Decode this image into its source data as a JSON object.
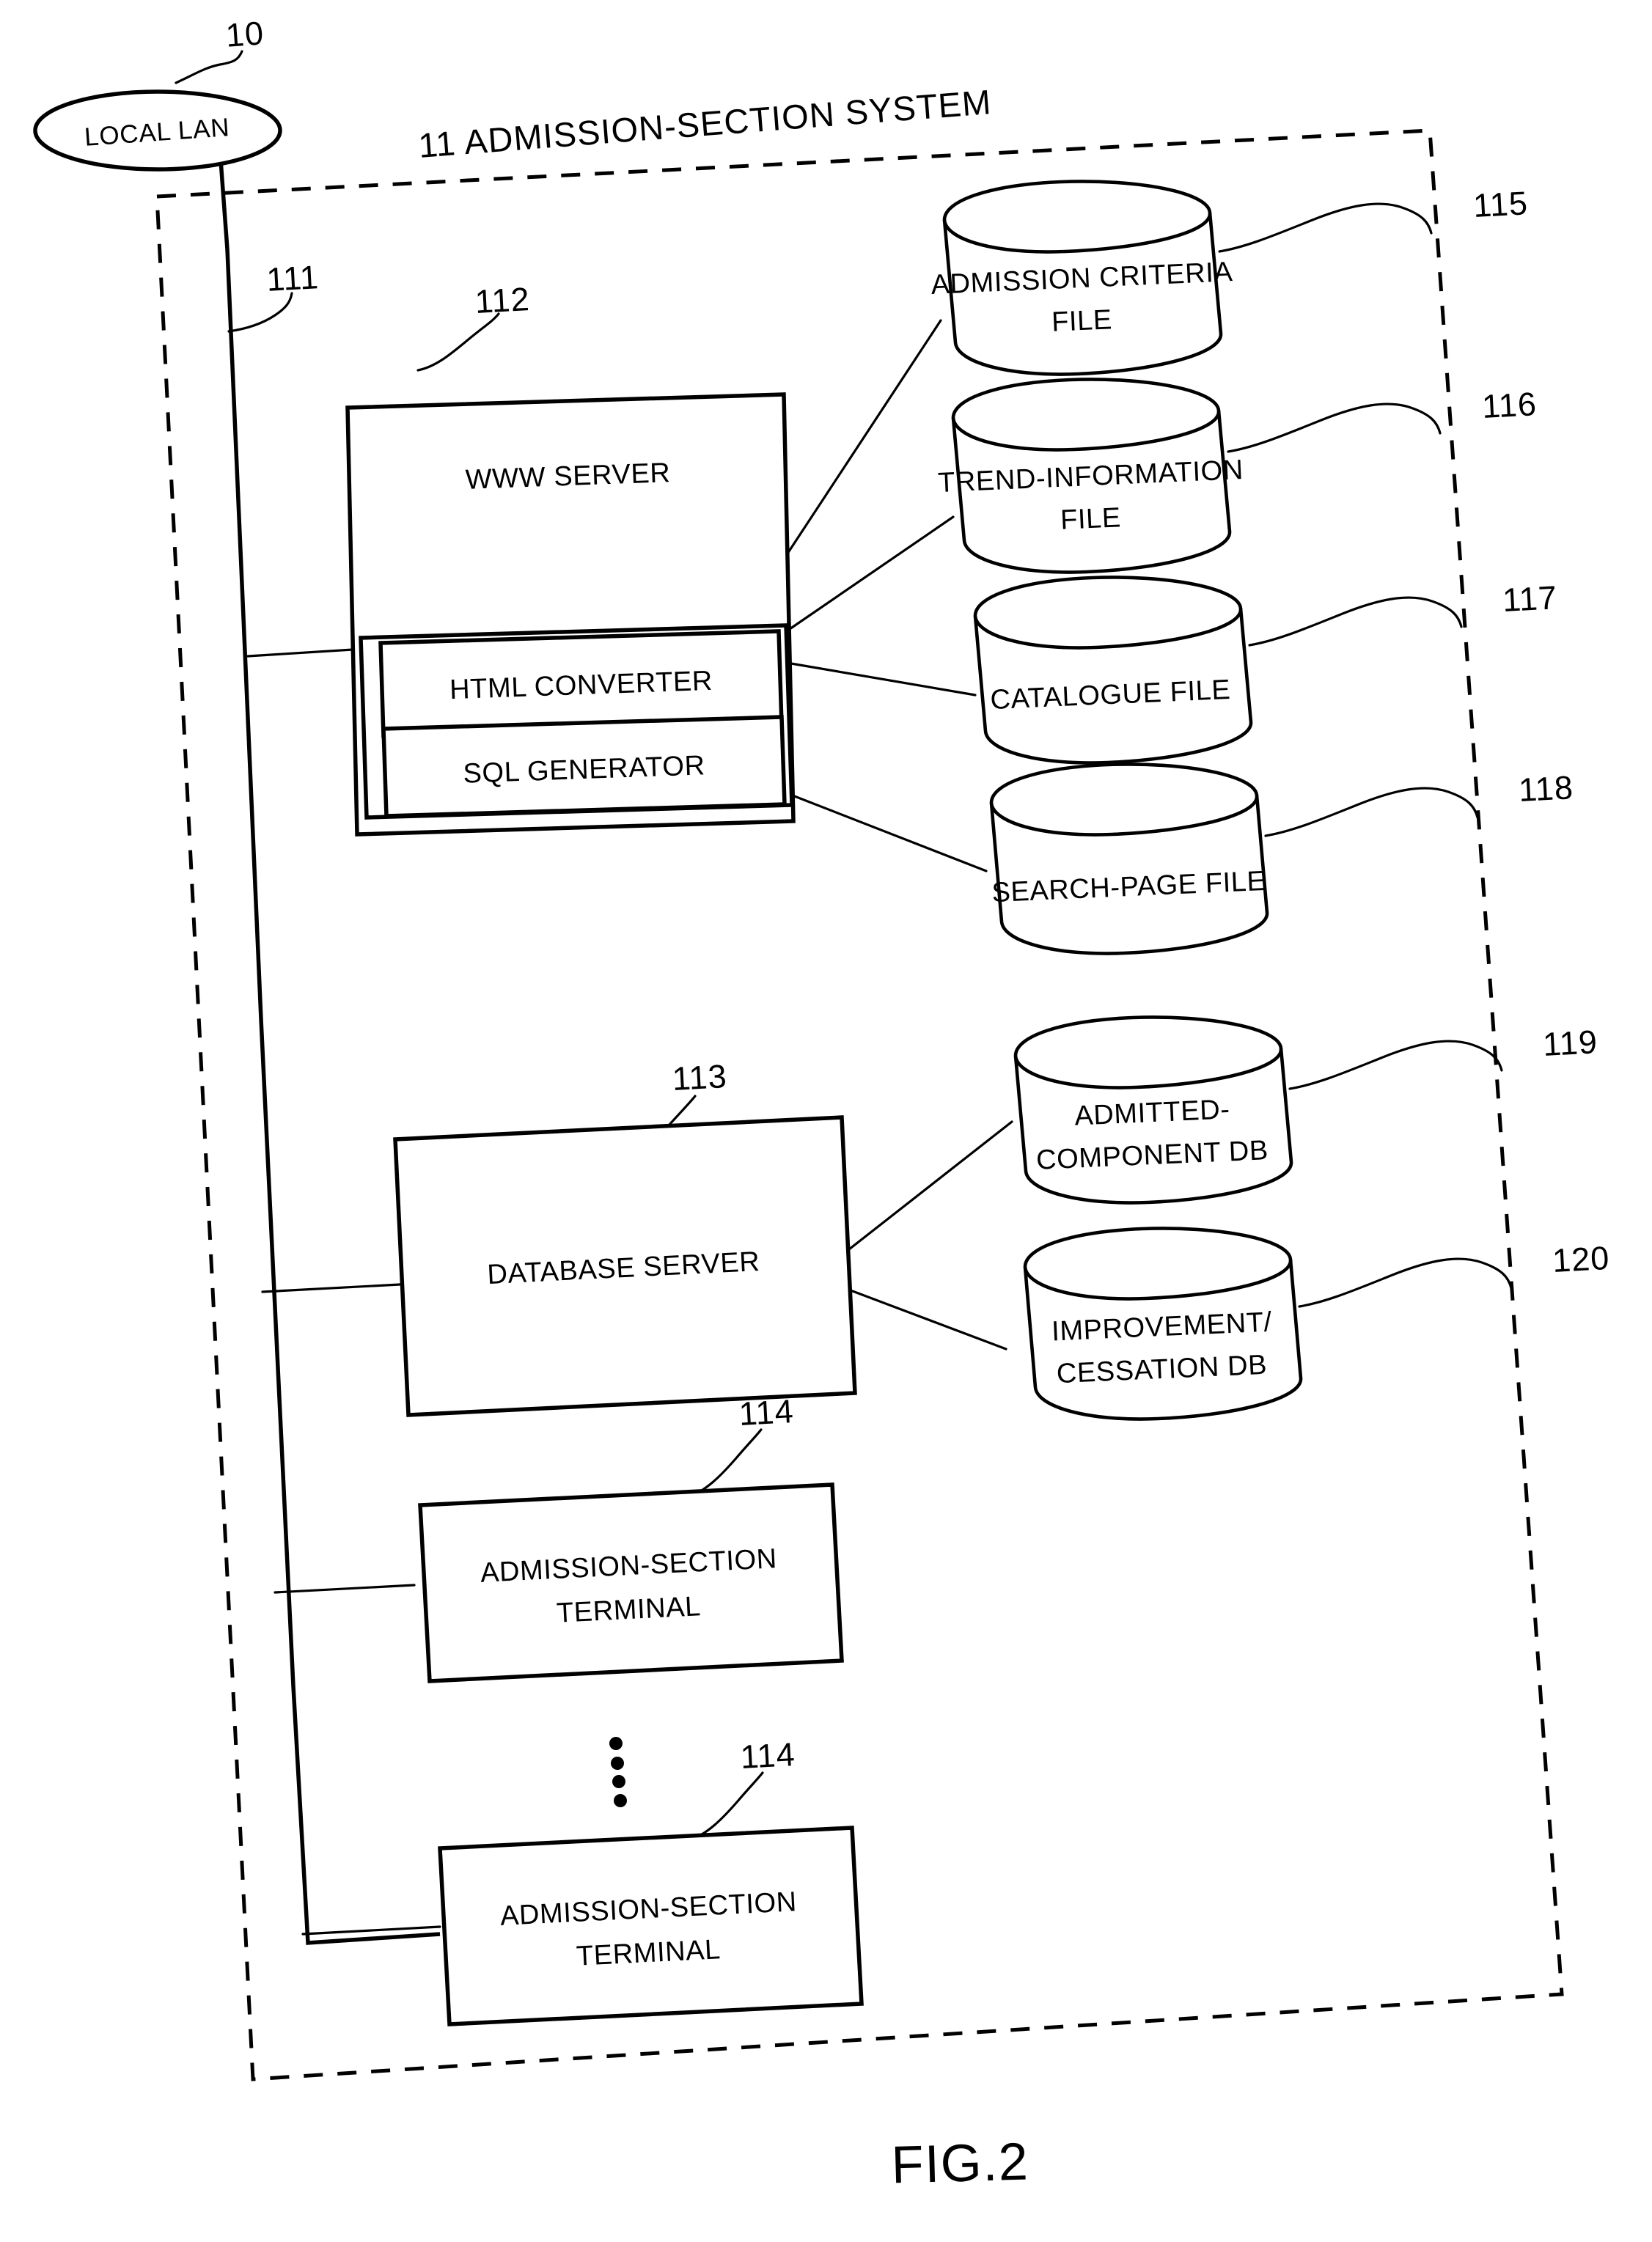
{
  "figure": {
    "label": "FIG.2",
    "caption_number": "2"
  },
  "network": {
    "lan_node_label": "LOCAL LAN",
    "lan_node_ref": "10",
    "bus_ref": "111"
  },
  "system": {
    "boundary_ref": "11",
    "boundary_title": "11 ADMISSION-SECTION SYSTEM",
    "title_text": "ADMISSION-SECTION SYSTEM"
  },
  "nodes": [
    {
      "id": "www-server",
      "ref": "112",
      "label": "WWW SERVER",
      "subcomponents": [
        {
          "id": "html-converter",
          "label": "HTML CONVERTER"
        },
        {
          "id": "sql-generator",
          "label": "SQL GENERATOR"
        }
      ]
    },
    {
      "id": "database-server",
      "ref": "113",
      "label": "DATABASE SERVER",
      "subcomponents": []
    },
    {
      "id": "admission-section-terminal-1",
      "ref": "114",
      "label_line1": "ADMISSION-SECTION",
      "label_line2": "TERMINAL",
      "subcomponents": []
    },
    {
      "id": "admission-section-terminal-n",
      "ref": "114",
      "label_line1": "ADMISSION-SECTION",
      "label_line2": "TERMINAL",
      "subcomponents": []
    }
  ],
  "stores": [
    {
      "id": "admission-criteria-file",
      "ref": "115",
      "line1": "ADMISSION CRITERIA",
      "line2": "FILE",
      "connects_to": "www-server"
    },
    {
      "id": "trend-information-file",
      "ref": "116",
      "line1": "TREND-INFORMATION",
      "line2": "FILE",
      "connects_to": "www-server"
    },
    {
      "id": "catalogue-file",
      "ref": "117",
      "line1": "CATALOGUE FILE",
      "line2": "",
      "connects_to": "www-server"
    },
    {
      "id": "search-page-file",
      "ref": "118",
      "line1": "SEARCH-PAGE FILE",
      "line2": "",
      "connects_to": "www-server"
    },
    {
      "id": "admitted-component-db",
      "ref": "119",
      "line1": "ADMITTED-",
      "line2": "COMPONENT DB",
      "connects_to": "database-server"
    },
    {
      "id": "improvement-cessation-db",
      "ref": "120",
      "line1": "IMPROVEMENT/",
      "line2": "CESSATION DB",
      "connects_to": "database-server"
    }
  ],
  "ellipsis": {
    "label": "vertical-ellipsis",
    "dot_count": 4
  },
  "colors": {
    "ink": "#000000",
    "paper": "#ffffff"
  }
}
